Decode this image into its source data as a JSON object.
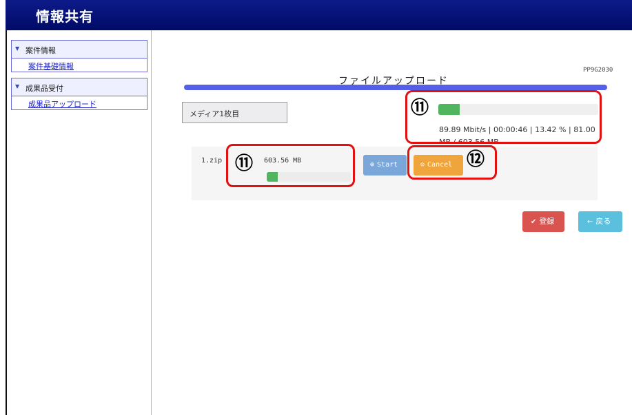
{
  "app": {
    "title": "情報共有"
  },
  "sidebar": {
    "sections": [
      {
        "label": "案件情報",
        "items": [
          {
            "label": "案件基礎情報"
          }
        ]
      },
      {
        "label": "成果品受付",
        "items": [
          {
            "label": "成果品アップロード"
          }
        ]
      }
    ]
  },
  "main": {
    "screen_id": "PP9G2030",
    "page_title": "ファイルアップロード",
    "media_label": "メディア1枚目",
    "overall_upload": {
      "progress_percent": 13.42,
      "status_text": "89.89 Mbit/s | 00:00:46 | 13.42 % | 81.00",
      "status_text_2": "MB / 603.56 MB"
    },
    "file": {
      "name": "1.zip",
      "size": "603.56 MB",
      "progress_percent": 13.42
    },
    "buttons": {
      "start": "Start",
      "cancel": "Cancel",
      "register": "登録",
      "back": "戻る"
    }
  },
  "annotations": {
    "label_11": "⑪",
    "label_12": "⑫"
  },
  "icons": {
    "chevron": "chevron-down-icon",
    "start": "upload-circle-icon",
    "cancel": "ban-icon",
    "register": "check-icon",
    "back": "arrow-left-icon"
  },
  "colors": {
    "title_bg": "#000a66",
    "progress": "#51b45f",
    "start_button": "#7aa6da",
    "cancel_button": "#f0a43c",
    "register_button": "#d9534f",
    "back_button": "#5bc0de",
    "annotation": "#e11111"
  }
}
